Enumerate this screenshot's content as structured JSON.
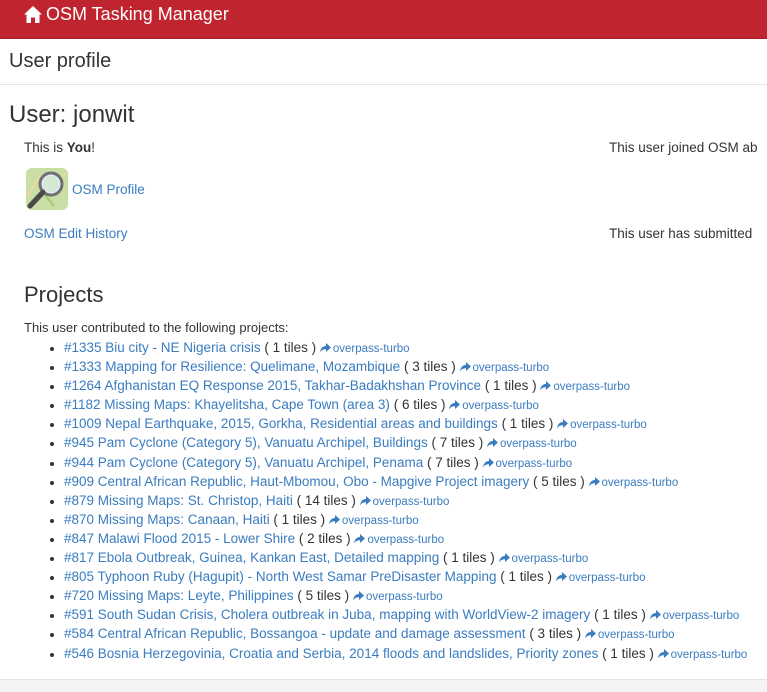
{
  "navbar": {
    "brand": "OSM Tasking Manager"
  },
  "page": {
    "title": "User profile",
    "user_heading": "User: jonwit",
    "this_is_prefix": "This is ",
    "this_is_you": "You",
    "this_is_suffix": "!",
    "joined_text": "This user joined OSM ab",
    "osm_profile_link": "OSM Profile",
    "edit_history_link": "OSM Edit History",
    "submitted_text": "This user has submitted"
  },
  "projects": {
    "heading": "Projects",
    "intro": "This user contributed to the following projects:",
    "overpass_label": "overpass-turbo",
    "items": [
      {
        "id_title": "#1335 Biu city - NE Nigeria crisis",
        "tiles": "( 1 tiles )"
      },
      {
        "id_title": "#1333 Mapping for Resilience: Quelimane, Mozambique",
        "tiles": "( 3 tiles )"
      },
      {
        "id_title": "#1264 Afghanistan EQ Response 2015, Takhar-Badakhshan Province",
        "tiles": "( 1 tiles )"
      },
      {
        "id_title": "#1182 Missing Maps: Khayelitsha, Cape Town (area 3)",
        "tiles": "( 6 tiles )"
      },
      {
        "id_title": "#1009 Nepal Earthquake, 2015, Gorkha, Residential areas and buildings",
        "tiles": "( 1 tiles )"
      },
      {
        "id_title": "#945 Pam Cyclone (Category 5), Vanuatu Archipel, Buildings",
        "tiles": "( 7 tiles )"
      },
      {
        "id_title": "#944 Pam Cyclone (Category 5), Vanuatu Archipel, Penama",
        "tiles": "( 7 tiles )"
      },
      {
        "id_title": "#909 Central African Republic, Haut-Mbomou, Obo - Mapgive Project imagery",
        "tiles": "( 5 tiles )"
      },
      {
        "id_title": "#879 Missing Maps: St. Christop, Haiti",
        "tiles": "( 14 tiles )"
      },
      {
        "id_title": "#870 Missing Maps: Canaan, Haiti",
        "tiles": "( 1 tiles )"
      },
      {
        "id_title": "#847 Malawi Flood 2015 - Lower Shire",
        "tiles": "( 2 tiles )"
      },
      {
        "id_title": "#817 Ebola Outbreak, Guinea, Kankan East, Detailed mapping",
        "tiles": "( 1 tiles )"
      },
      {
        "id_title": "#805 Typhoon Ruby (Hagupit) - North West Samar PreDisaster Mapping",
        "tiles": "( 1 tiles )"
      },
      {
        "id_title": "#720 Missing Maps: Leyte, Philippines",
        "tiles": "( 5 tiles )"
      },
      {
        "id_title": "#591 South Sudan Crisis, Cholera outbreak in Juba, mapping with WorldView-2 imagery",
        "tiles": "( 1 tiles )"
      },
      {
        "id_title": "#584 Central African Republic, Bossangoa - update and damage assessment",
        "tiles": "( 3 tiles )"
      },
      {
        "id_title": "#546 Bosnia Herzegovinia, Croatia and Serbia, 2014 floods and landslides, Priority zones",
        "tiles": "( 1 tiles )"
      }
    ]
  }
}
